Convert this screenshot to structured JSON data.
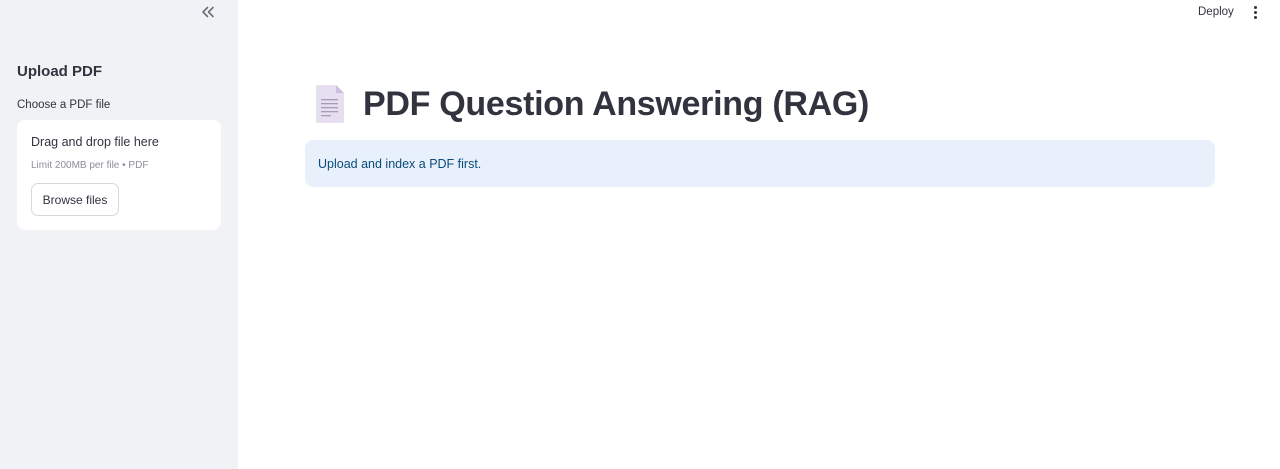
{
  "sidebar": {
    "collapse_icon": "double-chevron-left-icon",
    "header": "Upload PDF",
    "uploader": {
      "label": "Choose a PDF file",
      "dropzone_title": "Drag and drop file here",
      "limit_text": "Limit 200MB per file • PDF",
      "browse_label": "Browse files"
    }
  },
  "toolbar": {
    "deploy_label": "Deploy",
    "menu_icon": "kebab-menu-icon"
  },
  "main": {
    "title_icon": "page-facing-up-icon",
    "title": "PDF Question Answering (RAG)",
    "info_message": "Upload and index a PDF first."
  },
  "colors": {
    "sidebar_bg": "#f0f2f6",
    "info_bg": "#e8f1fb",
    "info_text": "#0a4a7c",
    "text": "#31333f"
  }
}
